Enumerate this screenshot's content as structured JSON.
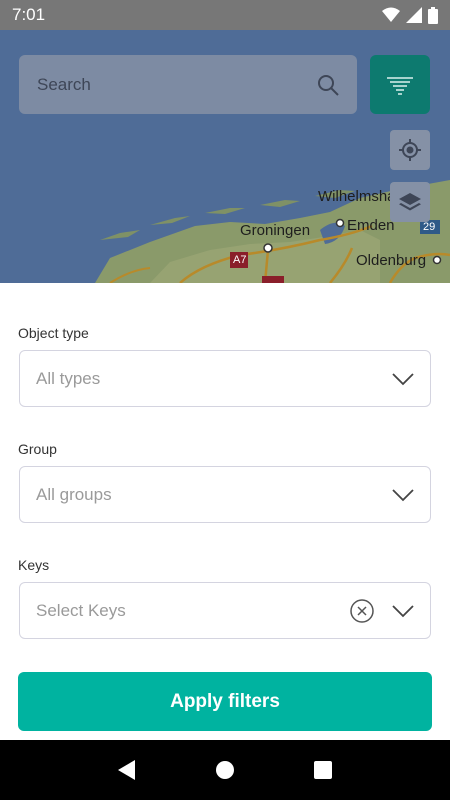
{
  "status_bar": {
    "time": "7:01",
    "icons": [
      "wifi-icon",
      "signal-icon",
      "battery-icon"
    ]
  },
  "map": {
    "search": {
      "placeholder": "Search"
    },
    "labels": {
      "groningen": "Groningen",
      "wilhelmshaven": "Wilhelmsha",
      "emden": "Emden",
      "oldenburg": "Oldenburg",
      "road_a7": "A7",
      "road_29": "29"
    },
    "buttons": [
      "filter-icon",
      "my-location-icon",
      "layers-icon"
    ]
  },
  "filters": {
    "object_type": {
      "label": "Object type",
      "placeholder": "All types"
    },
    "group": {
      "label": "Group",
      "placeholder": "All groups"
    },
    "keys": {
      "label": "Keys",
      "placeholder": "Select Keys"
    },
    "apply_label": "Apply filters"
  },
  "colors": {
    "accent": "#00b3a0",
    "map_water": "#4f6c97",
    "filter_button": "#0d7a6f"
  },
  "nav_bar": {
    "buttons": [
      "back-icon",
      "home-icon",
      "recents-icon"
    ]
  }
}
